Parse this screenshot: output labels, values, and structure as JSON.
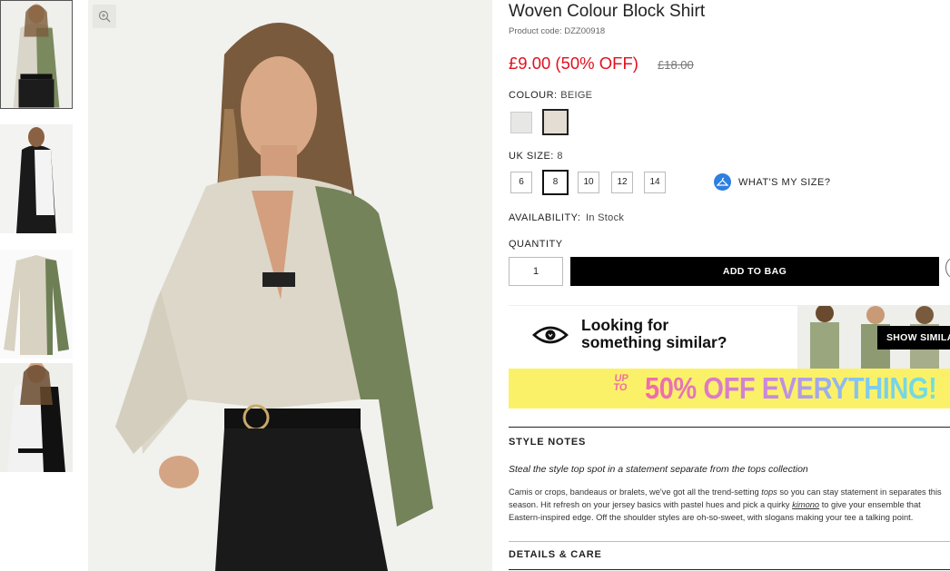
{
  "product": {
    "title": "Woven Colour Block Shirt",
    "code": "Product code: DZZ00918",
    "price": "£9.00 (50% OFF)",
    "old_price": "£18.00",
    "price_color": "#e0101e"
  },
  "colour": {
    "label": "COLOUR:",
    "value": "BEIGE",
    "swatches": [
      "#e7e7e6",
      "#e3ddd3"
    ]
  },
  "size": {
    "label": "UK SIZE:",
    "value": "8",
    "options": [
      "6",
      "8",
      "10",
      "12",
      "14"
    ],
    "help": "WHAT'S MY SIZE?"
  },
  "availability": {
    "label": "AVAILABILITY:",
    "value": "In Stock"
  },
  "quantity": {
    "label": "QUANTITY",
    "value": "1"
  },
  "cta": {
    "add_to_bag": "ADD TO BAG"
  },
  "similar": {
    "line1": "Looking for",
    "line2": "something similar?",
    "button": "SHOW SIMILAR"
  },
  "banner": {
    "prefix_top": "UP",
    "prefix_bottom": "TO",
    "text": "50% OFF EVERYTHING!"
  },
  "style_notes": {
    "heading": "STYLE NOTES",
    "lead": "Steal the style top spot in a statement separate from the tops collection",
    "p1_a": "Camis or crops, bandeaus or bralets, we've got all the trend-setting ",
    "p1_em": "tops",
    "p1_b": " so you can stay statement in separates this",
    "p2_a": "season. Hit refresh on your jersey basics with pastel hues and pick a quirky ",
    "p2_link": "kimono",
    "p2_b": " to give your ensemble that",
    "p3": "Eastern-inspired edge. Off the shoulder styles are oh-so-sweet, with slogans making your tee a talking point."
  },
  "details": {
    "heading": "DETAILS & CARE"
  },
  "icons": {
    "zoom": "zoom-icon",
    "eye": "eye-icon",
    "hanger": "hanger-icon"
  }
}
